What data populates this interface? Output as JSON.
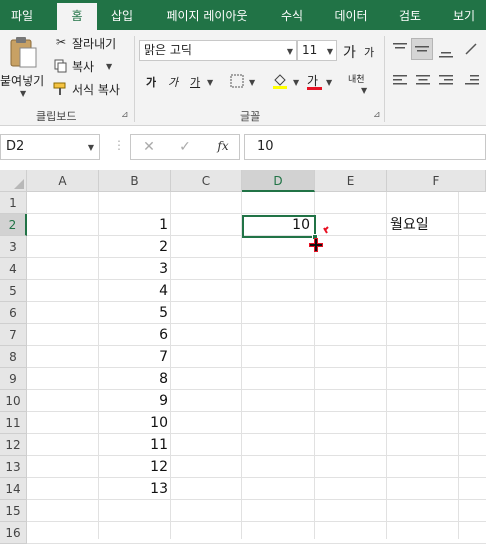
{
  "tabs": [
    "파일",
    "홈",
    "삽입",
    "페이지 레이아웃",
    "수식",
    "데이터",
    "검토",
    "보기"
  ],
  "clipboard": {
    "paste_label": "붙여넣기",
    "cut_label": "잘라내기",
    "copy_label": "복사",
    "format_painter_label": "서식 복사",
    "group_label": "클립보드"
  },
  "font": {
    "name": "맑은 고딕",
    "size": "11",
    "group_label": "글꼴",
    "grow_label": "가",
    "shrink_label": "가",
    "bold_label": "가",
    "italic_label": "가",
    "underline_label": "가",
    "font_color_label": "가",
    "phonetic_label": "내천"
  },
  "formula_bar": {
    "name_box": "D2",
    "fx_label": "fx",
    "content": "10"
  },
  "columns": [
    "A",
    "B",
    "C",
    "D",
    "E",
    "F"
  ],
  "rows": [
    "1",
    "2",
    "3",
    "4",
    "5",
    "6",
    "7",
    "8",
    "9",
    "10",
    "11",
    "12",
    "13",
    "14",
    "15",
    "16"
  ],
  "cells": {
    "B": [
      "",
      "1",
      "2",
      "3",
      "4",
      "5",
      "6",
      "7",
      "8",
      "9",
      "10",
      "11",
      "12",
      "13",
      "",
      ""
    ],
    "D2": "10",
    "F2": "월요일"
  },
  "colors": {
    "brand": "#217346",
    "font_color_bar": "#e81123",
    "highlight_bar": "#ffff00"
  }
}
